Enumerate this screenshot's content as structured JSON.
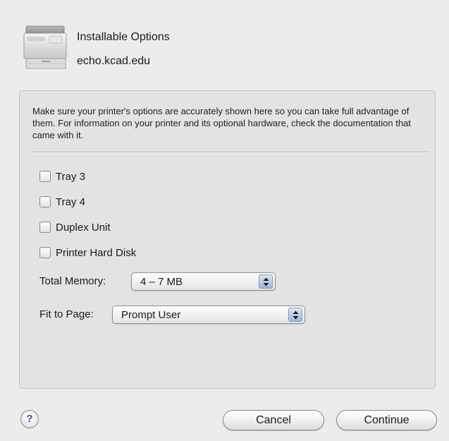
{
  "header": {
    "title": "Installable Options",
    "printer_name": "echo.kcad.edu",
    "icon": "printer-icon"
  },
  "description": "Make sure your printer's options are accurately shown here so you can take full advantage of them.  For information on your printer and its optional hardware, check the documentation that came with it.",
  "options": [
    {
      "label": "Tray 3",
      "checked": false
    },
    {
      "label": "Tray 4",
      "checked": false
    },
    {
      "label": "Duplex Unit",
      "checked": false
    },
    {
      "label": "Printer Hard Disk",
      "checked": false
    }
  ],
  "memory": {
    "label": "Total Memory:",
    "value": "4 – 7 MB"
  },
  "fit_to_page": {
    "label": "Fit to Page:",
    "value": "Prompt User"
  },
  "buttons": {
    "help": "?",
    "cancel": "Cancel",
    "continue": "Continue"
  },
  "colors": {
    "dialog_bg": "#ececec",
    "group_bg": "#e3e3e3",
    "help_glyph": "#5a3ea8"
  }
}
